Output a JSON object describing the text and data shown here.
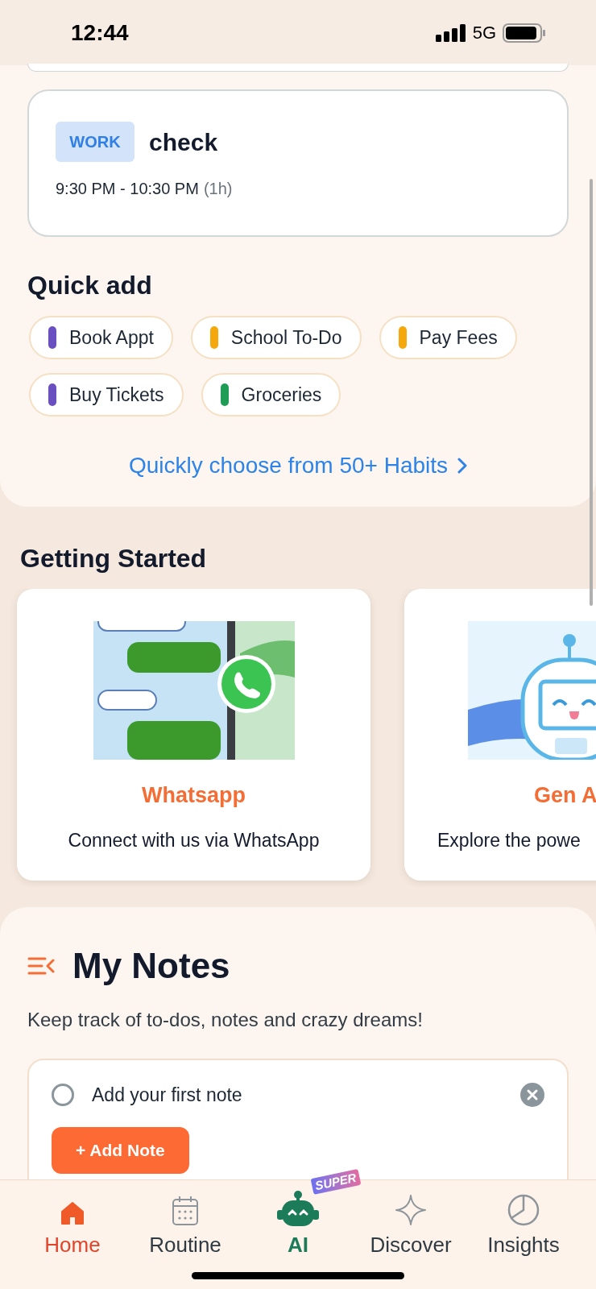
{
  "status_bar": {
    "time": "12:44",
    "network": "5G"
  },
  "event": {
    "tag": "WORK",
    "title": "check",
    "time": "9:30 PM - 10:30 PM",
    "duration": "(1h)"
  },
  "quick_add": {
    "title": "Quick add",
    "chips": [
      {
        "label": "Book Appt",
        "color": "#6a4fc0"
      },
      {
        "label": "School To-Do",
        "color": "#f5a80b"
      },
      {
        "label": "Pay Fees",
        "color": "#f5a80b"
      },
      {
        "label": "Buy Tickets",
        "color": "#6a4fc0"
      },
      {
        "label": "Groceries",
        "color": "#1f9d57"
      }
    ],
    "link": "Quickly choose from 50+ Habits"
  },
  "getting_started": {
    "title": "Getting Started",
    "cards": [
      {
        "kind": "whatsapp",
        "title": "Whatsapp",
        "description": "Connect with us via WhatsApp"
      },
      {
        "kind": "robot",
        "title": "Gen A",
        "description": "Explore the powe"
      }
    ]
  },
  "notes": {
    "title": "My Notes",
    "subtitle": "Keep track of to-dos, notes and crazy dreams!",
    "items": [
      {
        "placeholder": "Add your first note",
        "checked": false
      }
    ],
    "add_button": "+ Add Note"
  },
  "nav": [
    {
      "label": "Home",
      "selected": true
    },
    {
      "label": "Routine",
      "selected": false
    },
    {
      "label": "AI",
      "selected": false,
      "badge": "SUPER"
    },
    {
      "label": "Discover",
      "selected": false
    },
    {
      "label": "Insights",
      "selected": false
    }
  ]
}
